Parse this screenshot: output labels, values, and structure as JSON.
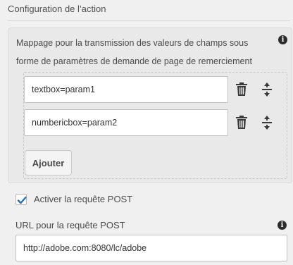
{
  "section": {
    "title": "Configuration de l’action"
  },
  "mapping": {
    "description": "Mappage pour la transmission des valeurs de champs sous forme de paramètres de demande de page de remerciement",
    "info_icon": "info-icon",
    "rows": [
      {
        "value": "textbox=param1",
        "delete_icon": "trash-icon",
        "reorder_icon": "move-vertical-icon"
      },
      {
        "value": "numbericbox=param2",
        "delete_icon": "trash-icon",
        "reorder_icon": "move-vertical-icon"
      }
    ],
    "add_label": "Ajouter"
  },
  "post": {
    "checkbox_label": "Activer la requête POST",
    "checked": true,
    "url_label": "URL pour la requête POST",
    "url_value": "http://adobe.com:8080/lc/adobe",
    "info_icon": "info-icon"
  },
  "colors": {
    "accent": "#2c6eb5",
    "icon": "#3a3a3a"
  }
}
